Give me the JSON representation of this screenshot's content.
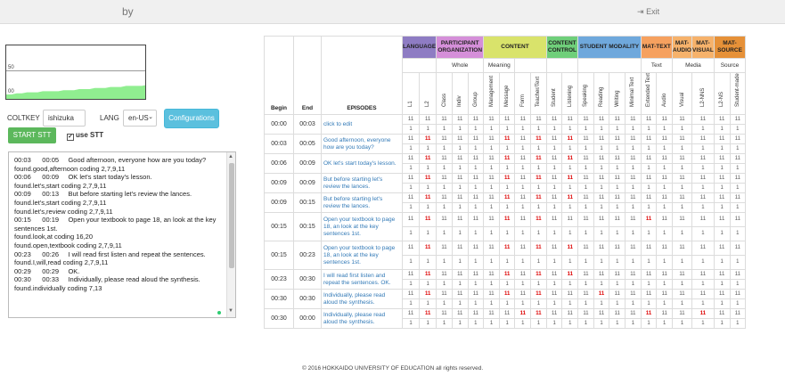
{
  "app": {
    "brand": "by",
    "exit_label": "Exit",
    "exit_icon": "exit-icon"
  },
  "chart_data": {
    "type": "area",
    "yticks": [
      "50",
      "00"
    ],
    "color": "#90ee90",
    "values": [
      0,
      0,
      1,
      1,
      2,
      2,
      2,
      3,
      3,
      3,
      3,
      4,
      4,
      4,
      5,
      5,
      5,
      6,
      6,
      6,
      7,
      7,
      7,
      8,
      8,
      8,
      8,
      9
    ]
  },
  "controls": {
    "coltkey_label": "COLTKEY",
    "coltkey_value": "ishizuka",
    "lang_label": "LANG",
    "lang_value": "en-US",
    "configurations_label": "Configurations",
    "start_label": "START STT",
    "use_stt_label": "use STT",
    "use_stt_checked": true
  },
  "log": [
    "00:03      00:05     Good afternoon, everyone how are you today?",
    "found.good,afternoon coding 2,7,9,11",
    "00:06      00:09     OK let's start today's lesson.",
    "found.let's,start coding 2,7,9,11",
    "00:09      00:13     But before starting let's review the lances.",
    "found.let's,start coding 2,7,9,11",
    "found.let's,review coding 2,7,9,11",
    "00:15      00:19     Open your textbook to page 18, an look at the key",
    "sentences 1st.",
    "found.look,at coding 16,20",
    "found.open,textbook coding 2,7,9,11",
    "00:23      00:26     I will read first listen and repeat the sentences.",
    "found.I,will,read coding 2,7,9,11",
    "00:29      00:29     OK.",
    "00:30      00:33     Individually, please read aloud the synthesis.",
    "found.individually coding 7,13"
  ],
  "table": {
    "categories": [
      {
        "label": "LANGUAGE",
        "span": 2,
        "color": "#8e7cc3"
      },
      {
        "label": "PARTICIPANT ORGANIZATION",
        "span": 3,
        "color": "#d58fd9"
      },
      {
        "label": "CONTENT",
        "span": 4,
        "color": "#d9e36b"
      },
      {
        "label": "CONTENT CONTROL",
        "span": 2,
        "color": "#6fcf7a"
      },
      {
        "label": "STUDENT MODALITY",
        "span": 4,
        "color": "#6fa8dc"
      },
      {
        "label": "MAT-TEXT",
        "span": 2,
        "color": "#f6a15f"
      },
      {
        "label": "MAT-AUDIO",
        "span": 1,
        "color": "#f6b26b"
      },
      {
        "label": "MAT-VISUAL",
        "span": 1,
        "color": "#f6b26b"
      },
      {
        "label": "MAT-SOURCE",
        "span": 3,
        "color": "#e69138"
      }
    ],
    "subgroups": [
      {
        "label": "",
        "span": 2
      },
      {
        "label": "Whole",
        "span": 3
      },
      {
        "label": "Meaning",
        "span": 2
      },
      {
        "label": "",
        "span": 2
      },
      {
        "label": "",
        "span": 2
      },
      {
        "label": "",
        "span": 4
      },
      {
        "label": "Text",
        "span": 2
      },
      {
        "label": "Media",
        "span": 2
      },
      {
        "label": "Source",
        "span": 3
      }
    ],
    "headers": {
      "begin": "Begin",
      "end": "End",
      "episodes": "EPISODES"
    },
    "columns": [
      "L1",
      "L2",
      "Class",
      "Indiv",
      "Group",
      "Management",
      "Message",
      "Form",
      "Teacher/Text",
      "Student",
      "Listening",
      "Speaking",
      "Reading",
      "Writing",
      "Minimal Text",
      "Extended Text",
      "Audio",
      "Visual",
      "L2-NNS",
      "L2-NS",
      "Student-made"
    ],
    "rows": [
      {
        "begin": "00:00",
        "end": "00:03",
        "episode": "click to edit",
        "red": []
      },
      {
        "begin": "00:03",
        "end": "00:05",
        "episode": "Good afternoon, everyone how are you today?",
        "red": [
          1,
          6,
          8,
          10
        ]
      },
      {
        "begin": "00:06",
        "end": "00:09",
        "episode": "OK let's start today's lesson.",
        "red": [
          1,
          6,
          8,
          10
        ]
      },
      {
        "begin": "00:09",
        "end": "00:09",
        "episode": "But before starting let's review the lances.",
        "red": [
          1,
          6,
          8,
          10
        ]
      },
      {
        "begin": "00:09",
        "end": "00:15",
        "episode": "But before starting let's review the lances.",
        "red": [
          1,
          6,
          8,
          10
        ]
      },
      {
        "begin": "00:15",
        "end": "00:15",
        "episode": "Open your textbook to page 18, an look at the key sentences 1st.",
        "red": [
          1,
          6,
          8,
          15
        ]
      },
      {
        "begin": "00:15",
        "end": "00:23",
        "episode": "Open your textbook to page 18, an look at the key sentences 1st.",
        "red": [
          1,
          6,
          8,
          10
        ]
      },
      {
        "begin": "00:23",
        "end": "00:30",
        "episode": "I will read first listen and repeat the sentences. OK.",
        "red": [
          1,
          6,
          8,
          10
        ]
      },
      {
        "begin": "00:30",
        "end": "00:30",
        "episode": "Individually, please read aloud the synthesis.",
        "red": [
          1,
          6,
          8,
          12
        ]
      },
      {
        "begin": "00:30",
        "end": "00:00",
        "episode": "Individually, please read aloud the synthesis.",
        "red": [
          1,
          7,
          8,
          15,
          18
        ]
      }
    ],
    "cell_top": "11",
    "cell_bottom": "1"
  },
  "footer": "© 2016 HOKKAIDO UNIVERSITY OF EDUCATION all rights reserved."
}
